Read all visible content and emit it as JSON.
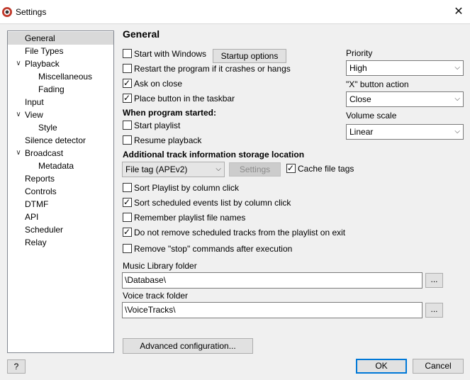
{
  "window": {
    "title": "Settings",
    "close_glyph": "✕"
  },
  "tree": {
    "items": [
      {
        "label": "General",
        "level": 0,
        "expander": ""
      },
      {
        "label": "File Types",
        "level": 0,
        "expander": ""
      },
      {
        "label": "Playback",
        "level": 0,
        "expander": "expanded"
      },
      {
        "label": "Miscellaneous",
        "level": 1,
        "expander": ""
      },
      {
        "label": "Fading",
        "level": 1,
        "expander": ""
      },
      {
        "label": "Input",
        "level": 0,
        "expander": ""
      },
      {
        "label": "View",
        "level": 0,
        "expander": "expanded"
      },
      {
        "label": "Style",
        "level": 1,
        "expander": ""
      },
      {
        "label": "Silence detector",
        "level": 0,
        "expander": ""
      },
      {
        "label": "Broadcast",
        "level": 0,
        "expander": "expanded"
      },
      {
        "label": "Metadata",
        "level": 1,
        "expander": ""
      },
      {
        "label": "Reports",
        "level": 0,
        "expander": ""
      },
      {
        "label": "Controls",
        "level": 0,
        "expander": ""
      },
      {
        "label": "DTMF",
        "level": 0,
        "expander": ""
      },
      {
        "label": "API",
        "level": 0,
        "expander": ""
      },
      {
        "label": "Scheduler",
        "level": 0,
        "expander": ""
      },
      {
        "label": "Relay",
        "level": 0,
        "expander": ""
      }
    ],
    "selected": "General"
  },
  "general": {
    "heading": "General",
    "start_with_windows": {
      "label": "Start with Windows",
      "checked": false
    },
    "startup_options_button": "Startup options",
    "restart_on_crash": {
      "label": "Restart the program if it crashes or hangs",
      "checked": false
    },
    "ask_on_close": {
      "label": "Ask on close",
      "checked": true
    },
    "taskbar_button": {
      "label": "Place button in the taskbar",
      "checked": true
    },
    "when_started_heading": "When program started:",
    "start_playlist": {
      "label": "Start playlist",
      "checked": false
    },
    "resume_playback": {
      "label": "Resume playback",
      "checked": false
    },
    "storage_heading": "Additional track information storage location",
    "storage_combo": "File tag (APEv2)",
    "settings_button": "Settings",
    "cache_file_tags": {
      "label": "Cache file tags",
      "checked": true
    },
    "sort_playlist": {
      "label": "Sort Playlist by column click",
      "checked": false
    },
    "sort_scheduled": {
      "label": "Sort scheduled events list by column click",
      "checked": true
    },
    "remember_names": {
      "label": "Remember playlist file names",
      "checked": false
    },
    "no_remove_scheduled": {
      "label": "Do not remove scheduled tracks from the playlist on exit",
      "checked": true
    },
    "remove_stop": {
      "label": "Remove \"stop\" commands after execution",
      "checked": false
    },
    "music_library_label": "Music Library folder",
    "music_library_value": "\\Database\\",
    "voice_track_label": "Voice track folder",
    "voice_track_value": "\\VoiceTracks\\",
    "browse_label": "...",
    "advanced_button": "Advanced configuration..."
  },
  "right_panel": {
    "priority_label": "Priority",
    "priority_value": "High",
    "x_button_label": "\"X\" button action",
    "x_button_value": "Close",
    "volume_scale_label": "Volume scale",
    "volume_scale_value": "Linear"
  },
  "footer": {
    "help_label": "?",
    "ok_label": "OK",
    "cancel_label": "Cancel"
  },
  "colors": {
    "accent": "#0078d7",
    "selection": "#d9d9d9",
    "background": "#f0f0f0"
  },
  "icons": {
    "app": "headphones-record-icon",
    "dropdown": "chevron-down-icon",
    "expander": "chevron-down-icon"
  }
}
